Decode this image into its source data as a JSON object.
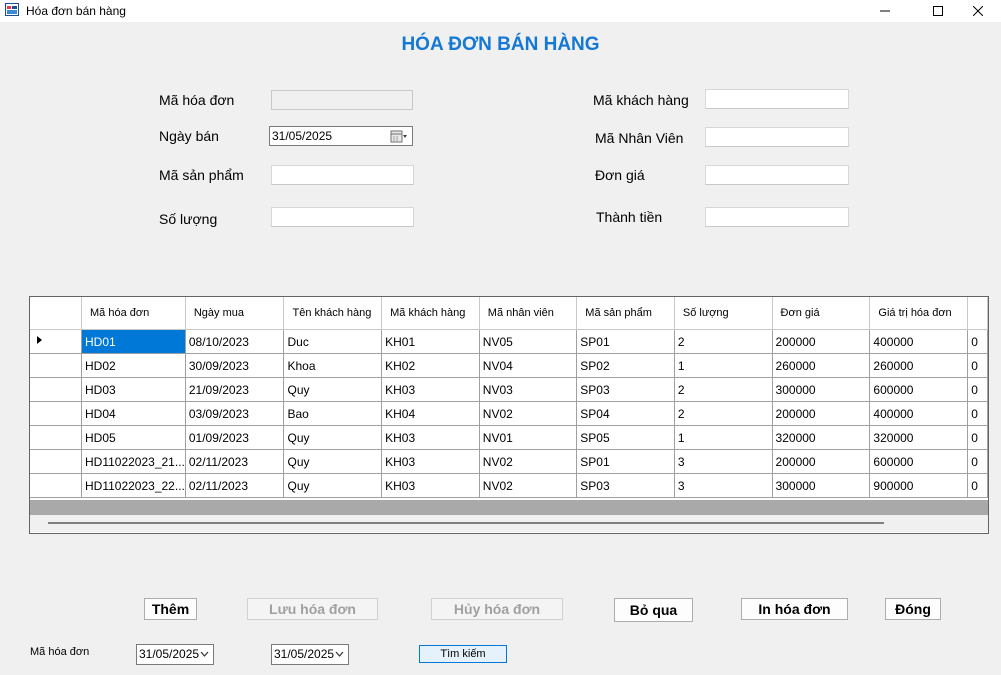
{
  "window": {
    "title": "Hóa đơn bán hàng"
  },
  "heading": "HÓA ĐƠN BÁN HÀNG",
  "form": {
    "ma_hoa_don_label": "Mã hóa đơn",
    "ngay_ban_label": "Ngày bán",
    "ngay_ban_value": "31/05/2025",
    "ma_san_pham_label": "Mã sản phẩm",
    "so_luong_label": "Số lượng",
    "ma_khach_hang_label": "Mã khách hàng",
    "ma_nhan_vien_label": "Mã Nhân Viên",
    "don_gia_label": "Đơn giá",
    "thanh_tien_label": "Thành tiền"
  },
  "grid": {
    "headers": [
      "Mã hóa đơn",
      "Ngày mua",
      "Tên khách hàng",
      "Mã khách hàng",
      "Mã nhân viên",
      "Mã sản phẩm",
      "Số lượng",
      "Đơn giá",
      "Giá trị hóa đơn"
    ],
    "rows": [
      [
        "HD01",
        "08/10/2023",
        "Duc",
        "KH01",
        "NV05",
        "SP01",
        "2",
        "200000",
        "400000"
      ],
      [
        "HD02",
        "30/09/2023",
        "Khoa",
        "KH02",
        "NV04",
        "SP02",
        "1",
        "260000",
        "260000"
      ],
      [
        "HD03",
        "21/09/2023",
        "Quy",
        "KH03",
        "NV03",
        "SP03",
        "2",
        "300000",
        "600000"
      ],
      [
        "HD04",
        "03/09/2023",
        "Bao",
        "KH04",
        "NV02",
        "SP04",
        "2",
        "200000",
        "400000"
      ],
      [
        "HD05",
        "01/09/2023",
        "Quy",
        "KH03",
        "NV01",
        "SP05",
        "1",
        "320000",
        "320000"
      ],
      [
        "HD11022023_21...",
        "02/11/2023",
        "Quy",
        "KH03",
        "NV02",
        "SP01",
        "3",
        "200000",
        "600000"
      ],
      [
        "HD11022023_22...",
        "02/11/2023",
        "Quy",
        "KH03",
        "NV02",
        "SP03",
        "3",
        "300000",
        "900000"
      ]
    ],
    "extra_col_partial": "0",
    "selected_row": 0
  },
  "buttons": {
    "them": "Thêm",
    "luu": "Lưu hóa đơn",
    "huy": "Hủy hóa đơn",
    "boqua": "Bỏ qua",
    "in": "In hóa đơn",
    "dong": "Đóng"
  },
  "search": {
    "label": "Mã hóa đơn",
    "date_from": "31/05/2025",
    "date_to": "31/05/2025",
    "button": "Tìm kiếm"
  },
  "colors": {
    "heading": "#1478d4",
    "selection": "#0078d7"
  }
}
